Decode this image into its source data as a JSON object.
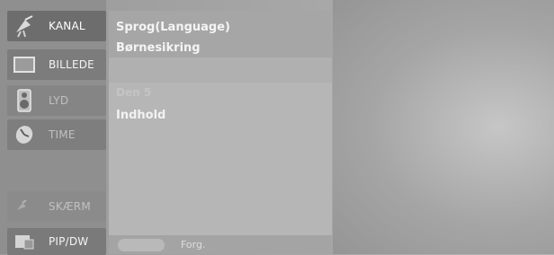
{
  "menu": {
    "items": [
      {
        "label": "KANAL",
        "icon": "antenna-icon"
      },
      {
        "label": "BILLEDE",
        "icon": "picture-icon"
      },
      {
        "label": "LYD",
        "icon": "speaker-icon"
      },
      {
        "label": "TIME",
        "icon": "clock-icon"
      },
      {
        "label": "SKÆRM",
        "icon": "screen-icon"
      },
      {
        "label": "PIP/DW",
        "icon": "pip-icon"
      }
    ]
  },
  "submenu": {
    "language": "Sprog(Language)",
    "child_lock": "Børnesikring",
    "faint_label": "Den 5",
    "content": "Indhold"
  },
  "bottom_bar": {
    "label": "Forg."
  }
}
